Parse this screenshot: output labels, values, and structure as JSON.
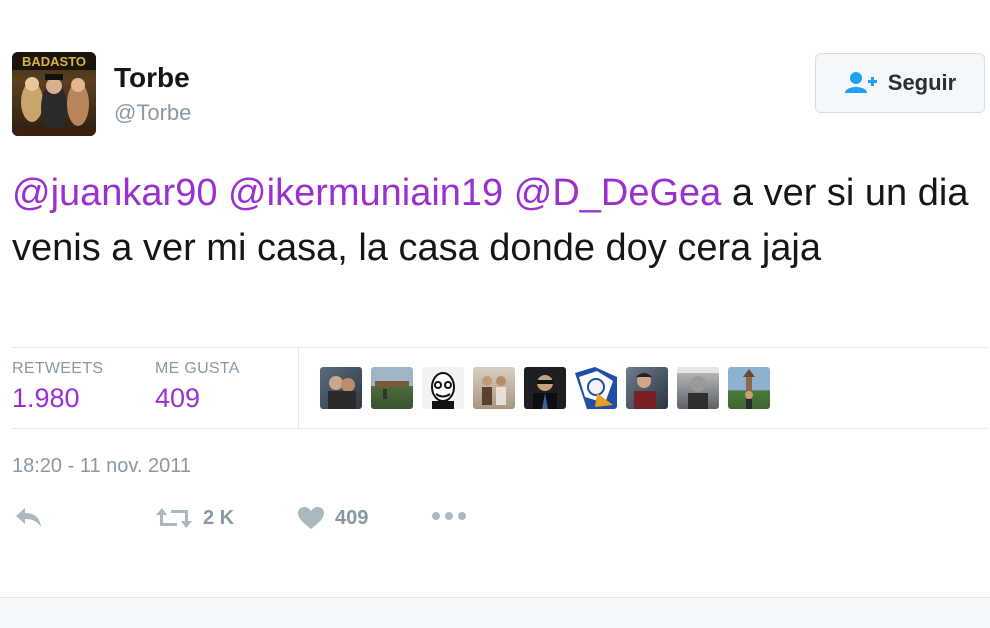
{
  "user": {
    "display_name": "Torbe",
    "handle": "@Torbe",
    "avatar_text": "BADASTO"
  },
  "follow_button": {
    "label": "Seguir",
    "icon": "add-user-icon"
  },
  "tweet": {
    "mentions": [
      "@juankar90",
      "@ikermuniain19",
      "@D_DeGea"
    ],
    "body": " a ver si un dia venis a ver mi casa, la casa donde doy cera jaja"
  },
  "stats": {
    "retweets_label": "RETWEETS",
    "retweets_value": "1.980",
    "likes_label": "ME GUSTA",
    "likes_value": "409"
  },
  "likers": [
    {
      "icon": "user-avatar-icon"
    },
    {
      "icon": "user-avatar-icon"
    },
    {
      "icon": "user-avatar-icon"
    },
    {
      "icon": "user-avatar-icon"
    },
    {
      "icon": "user-avatar-icon"
    },
    {
      "icon": "user-avatar-icon"
    },
    {
      "icon": "user-avatar-icon"
    },
    {
      "icon": "user-avatar-icon"
    },
    {
      "icon": "user-avatar-icon"
    }
  ],
  "timestamp": "18:20 - 11 nov. 2011",
  "actions": {
    "reply_icon": "reply-icon",
    "retweet_icon": "retweet-icon",
    "retweet_count": "2 K",
    "like_icon": "heart-icon",
    "like_count": "409",
    "more_icon": "more-dots-icon"
  },
  "colors": {
    "mention": "#9b30d0",
    "muted": "#8899a6",
    "text": "#14171a",
    "divider": "#e1e8ed"
  }
}
